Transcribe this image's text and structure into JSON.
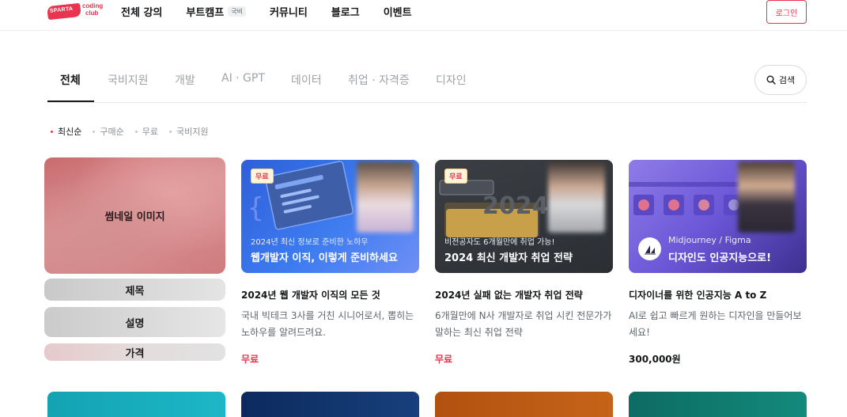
{
  "header": {
    "logo": {
      "badge_text": "SPARTA",
      "line1": "coding",
      "line2": "club"
    },
    "nav": [
      {
        "label": "전체 강의"
      },
      {
        "label": "부트캠프",
        "tag": "국비"
      },
      {
        "label": "커뮤니티"
      },
      {
        "label": "블로그"
      },
      {
        "label": "이벤트"
      }
    ],
    "login_label": "로그인"
  },
  "tabs": [
    {
      "label": "전체",
      "active": true
    },
    {
      "label": "국비지원"
    },
    {
      "label": "개발"
    },
    {
      "label": "AI · GPT"
    },
    {
      "label": "데이터"
    },
    {
      "label": "취업 · 자격증"
    },
    {
      "label": "디자인"
    }
  ],
  "search_label": "검색",
  "sorts": [
    {
      "label": "최신순",
      "active": true
    },
    {
      "label": "구매순"
    },
    {
      "label": "무료"
    },
    {
      "label": "국비지원"
    }
  ],
  "skeleton": {
    "thumb_label": "썸네일 이미지",
    "title_label": "제목",
    "desc_label": "설명",
    "price_label": "가격"
  },
  "cards": [
    {
      "badge": "무료",
      "thumb_sub": "2024년 최신 정보로 준비한 노하우",
      "thumb_main": "웹개발자 이직, 이렇게 준비하세요",
      "title": "2024년 웹 개발자 이직의 모든 것",
      "desc": "국내 빅테크 3사를 거친 시니어로서, 뽑히는 노하우를 알려드려요.",
      "price": "무료",
      "free": true
    },
    {
      "badge": "무료",
      "thumb_sub": "비전공자도 6개월만에 취업 가능!",
      "thumb_main": "2024 최신 개발자 취업 전략",
      "title": "2024년 실패 없는 개발자 취업 전략",
      "desc": "6개월만에 N사 개발자로 취업 시킨 전문가가 말하는 최신 취업 전략",
      "price": "무료",
      "free": true
    },
    {
      "thumb_sub": "Midjourney / Figma",
      "thumb_main": "디자인도 인공지능으로!",
      "title": "디자이너를 위한 인공지능 A to Z",
      "desc": "AI로 쉽고 빠르게 원하는 디자인을 만들어보세요!",
      "price": "300,000원",
      "free": false
    }
  ],
  "colors": {
    "brand": "#e8344e",
    "text": "#141617",
    "muted": "#9da3a8"
  }
}
